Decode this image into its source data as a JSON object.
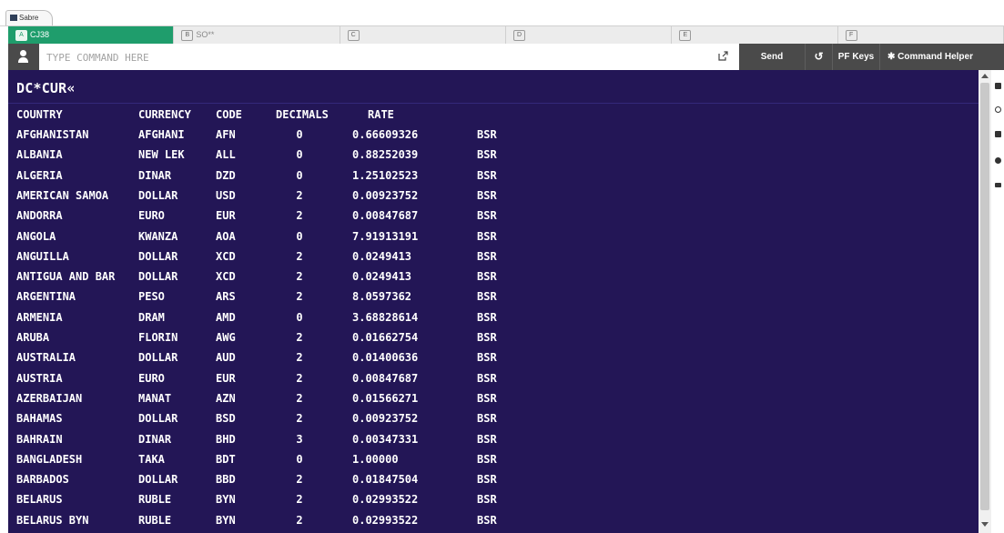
{
  "window": {
    "title": "Sabre"
  },
  "areas": [
    {
      "letter": "A",
      "label": "CJ38",
      "active": true
    },
    {
      "letter": "B",
      "label": "SO**",
      "active": false
    },
    {
      "letter": "C",
      "label": "",
      "active": false
    },
    {
      "letter": "D",
      "label": "",
      "active": false
    },
    {
      "letter": "E",
      "label": "",
      "active": false
    },
    {
      "letter": "F",
      "label": "",
      "active": false
    }
  ],
  "command_bar": {
    "placeholder": "TYPE COMMAND HERE",
    "value": "",
    "send_label": "Send",
    "history_icon": "history-icon",
    "pf_keys_label": "PF Keys",
    "helper_label": "Command Helper"
  },
  "terminal": {
    "command": "DC*CUR«",
    "header": {
      "country": "COUNTRY",
      "currency": "CURRENCY",
      "code": "CODE",
      "decimals": "DECIMALS",
      "rate": "RATE"
    },
    "rows": [
      {
        "country": "AFGHANISTAN",
        "currency": "AFGHANI",
        "code": "AFN",
        "decimals": "0",
        "rate": "0.66609326",
        "source": "BSR"
      },
      {
        "country": "ALBANIA",
        "currency": "NEW LEK",
        "code": "ALL",
        "decimals": "0",
        "rate": "0.88252039",
        "source": "BSR"
      },
      {
        "country": "ALGERIA",
        "currency": "DINAR",
        "code": "DZD",
        "decimals": "0",
        "rate": "1.25102523",
        "source": "BSR"
      },
      {
        "country": "AMERICAN SAMOA",
        "currency": "DOLLAR",
        "code": "USD",
        "decimals": "2",
        "rate": "0.00923752",
        "source": "BSR"
      },
      {
        "country": "ANDORRA",
        "currency": "EURO",
        "code": "EUR",
        "decimals": "2",
        "rate": "0.00847687",
        "source": "BSR"
      },
      {
        "country": "ANGOLA",
        "currency": "KWANZA",
        "code": "AOA",
        "decimals": "0",
        "rate": "7.91913191",
        "source": "BSR"
      },
      {
        "country": "ANGUILLA",
        "currency": "DOLLAR",
        "code": "XCD",
        "decimals": "2",
        "rate": "0.0249413",
        "source": "BSR"
      },
      {
        "country": "ANTIGUA AND BAR",
        "currency": "DOLLAR",
        "code": "XCD",
        "decimals": "2",
        "rate": "0.0249413",
        "source": "BSR"
      },
      {
        "country": "ARGENTINA",
        "currency": "PESO",
        "code": "ARS",
        "decimals": "2",
        "rate": "8.0597362",
        "source": "BSR"
      },
      {
        "country": "ARMENIA",
        "currency": "DRAM",
        "code": "AMD",
        "decimals": "0",
        "rate": "3.68828614",
        "source": "BSR"
      },
      {
        "country": "ARUBA",
        "currency": "FLORIN",
        "code": "AWG",
        "decimals": "2",
        "rate": "0.01662754",
        "source": "BSR"
      },
      {
        "country": "AUSTRALIA",
        "currency": "DOLLAR",
        "code": "AUD",
        "decimals": "2",
        "rate": "0.01400636",
        "source": "BSR"
      },
      {
        "country": "AUSTRIA",
        "currency": "EURO",
        "code": "EUR",
        "decimals": "2",
        "rate": "0.00847687",
        "source": "BSR"
      },
      {
        "country": "AZERBAIJAN",
        "currency": "MANAT",
        "code": "AZN",
        "decimals": "2",
        "rate": "0.01566271",
        "source": "BSR"
      },
      {
        "country": "BAHAMAS",
        "currency": "DOLLAR",
        "code": "BSD",
        "decimals": "2",
        "rate": "0.00923752",
        "source": "BSR"
      },
      {
        "country": "BAHRAIN",
        "currency": "DINAR",
        "code": "BHD",
        "decimals": "3",
        "rate": "0.00347331",
        "source": "BSR"
      },
      {
        "country": "BANGLADESH",
        "currency": "TAKA",
        "code": "BDT",
        "decimals": "0",
        "rate": "1.00000",
        "source": "BSR"
      },
      {
        "country": "BARBADOS",
        "currency": "DOLLAR",
        "code": "BBD",
        "decimals": "2",
        "rate": "0.01847504",
        "source": "BSR"
      },
      {
        "country": "BELARUS",
        "currency": "RUBLE",
        "code": "BYN",
        "decimals": "2",
        "rate": "0.02993522",
        "source": "BSR"
      },
      {
        "country": "BELARUS BYN",
        "currency": "RUBLE",
        "code": "BYN",
        "decimals": "2",
        "rate": "0.02993522",
        "source": "BSR"
      }
    ]
  },
  "colors": {
    "terminal_bg": "#231656",
    "active_area": "#1f9d6c",
    "toolbar": "#4a4a4a"
  }
}
